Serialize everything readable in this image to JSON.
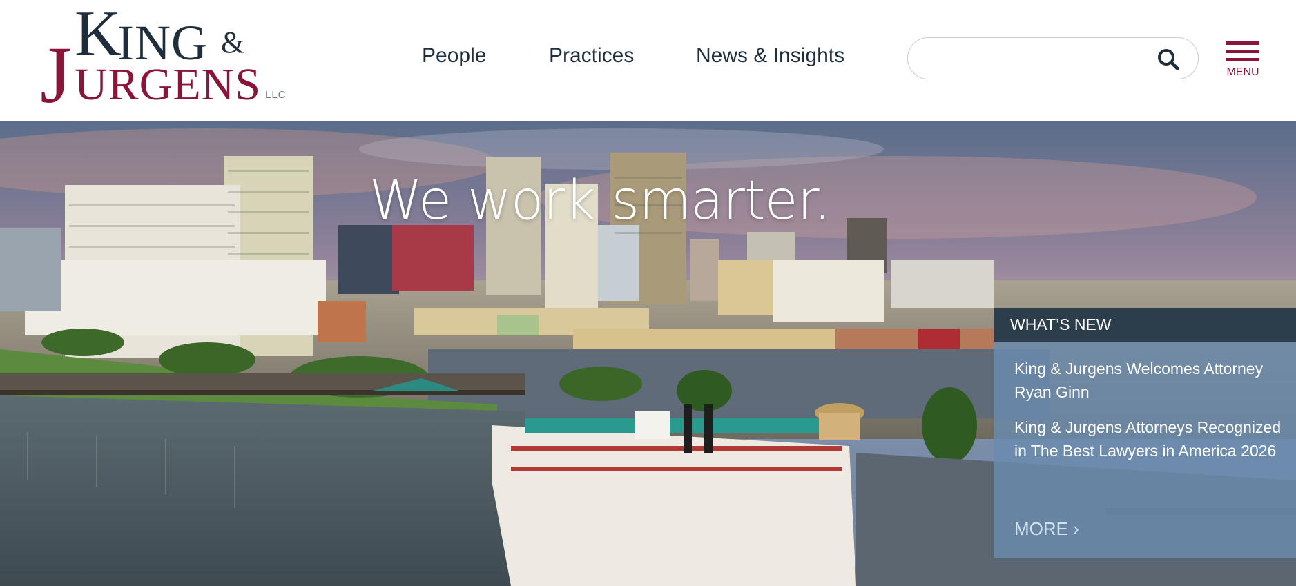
{
  "logo": {
    "k": "K",
    "ing": "ING",
    "amp": "&",
    "j": "J",
    "urgens": "URGENS",
    "llc": "LLC"
  },
  "nav": {
    "people": "People",
    "practices": "Practices",
    "news": "News & Insights"
  },
  "search": {
    "value": "",
    "placeholder": ""
  },
  "menu": {
    "label": "MENU"
  },
  "hero": {
    "headline": "We work smarter."
  },
  "whats_new": {
    "title": "WHAT’S NEW",
    "items": [
      "King & Jurgens Welcomes Attorney Ryan Ginn",
      "King & Jurgens Attorneys Recognized in The Best Lawyers in America 2026"
    ],
    "more": "MORE ›"
  },
  "colors": {
    "navy": "#1f2e3c",
    "maroon": "#8a1538",
    "panel_header": "#2c3e4c",
    "panel_body": "#6a8baf"
  }
}
